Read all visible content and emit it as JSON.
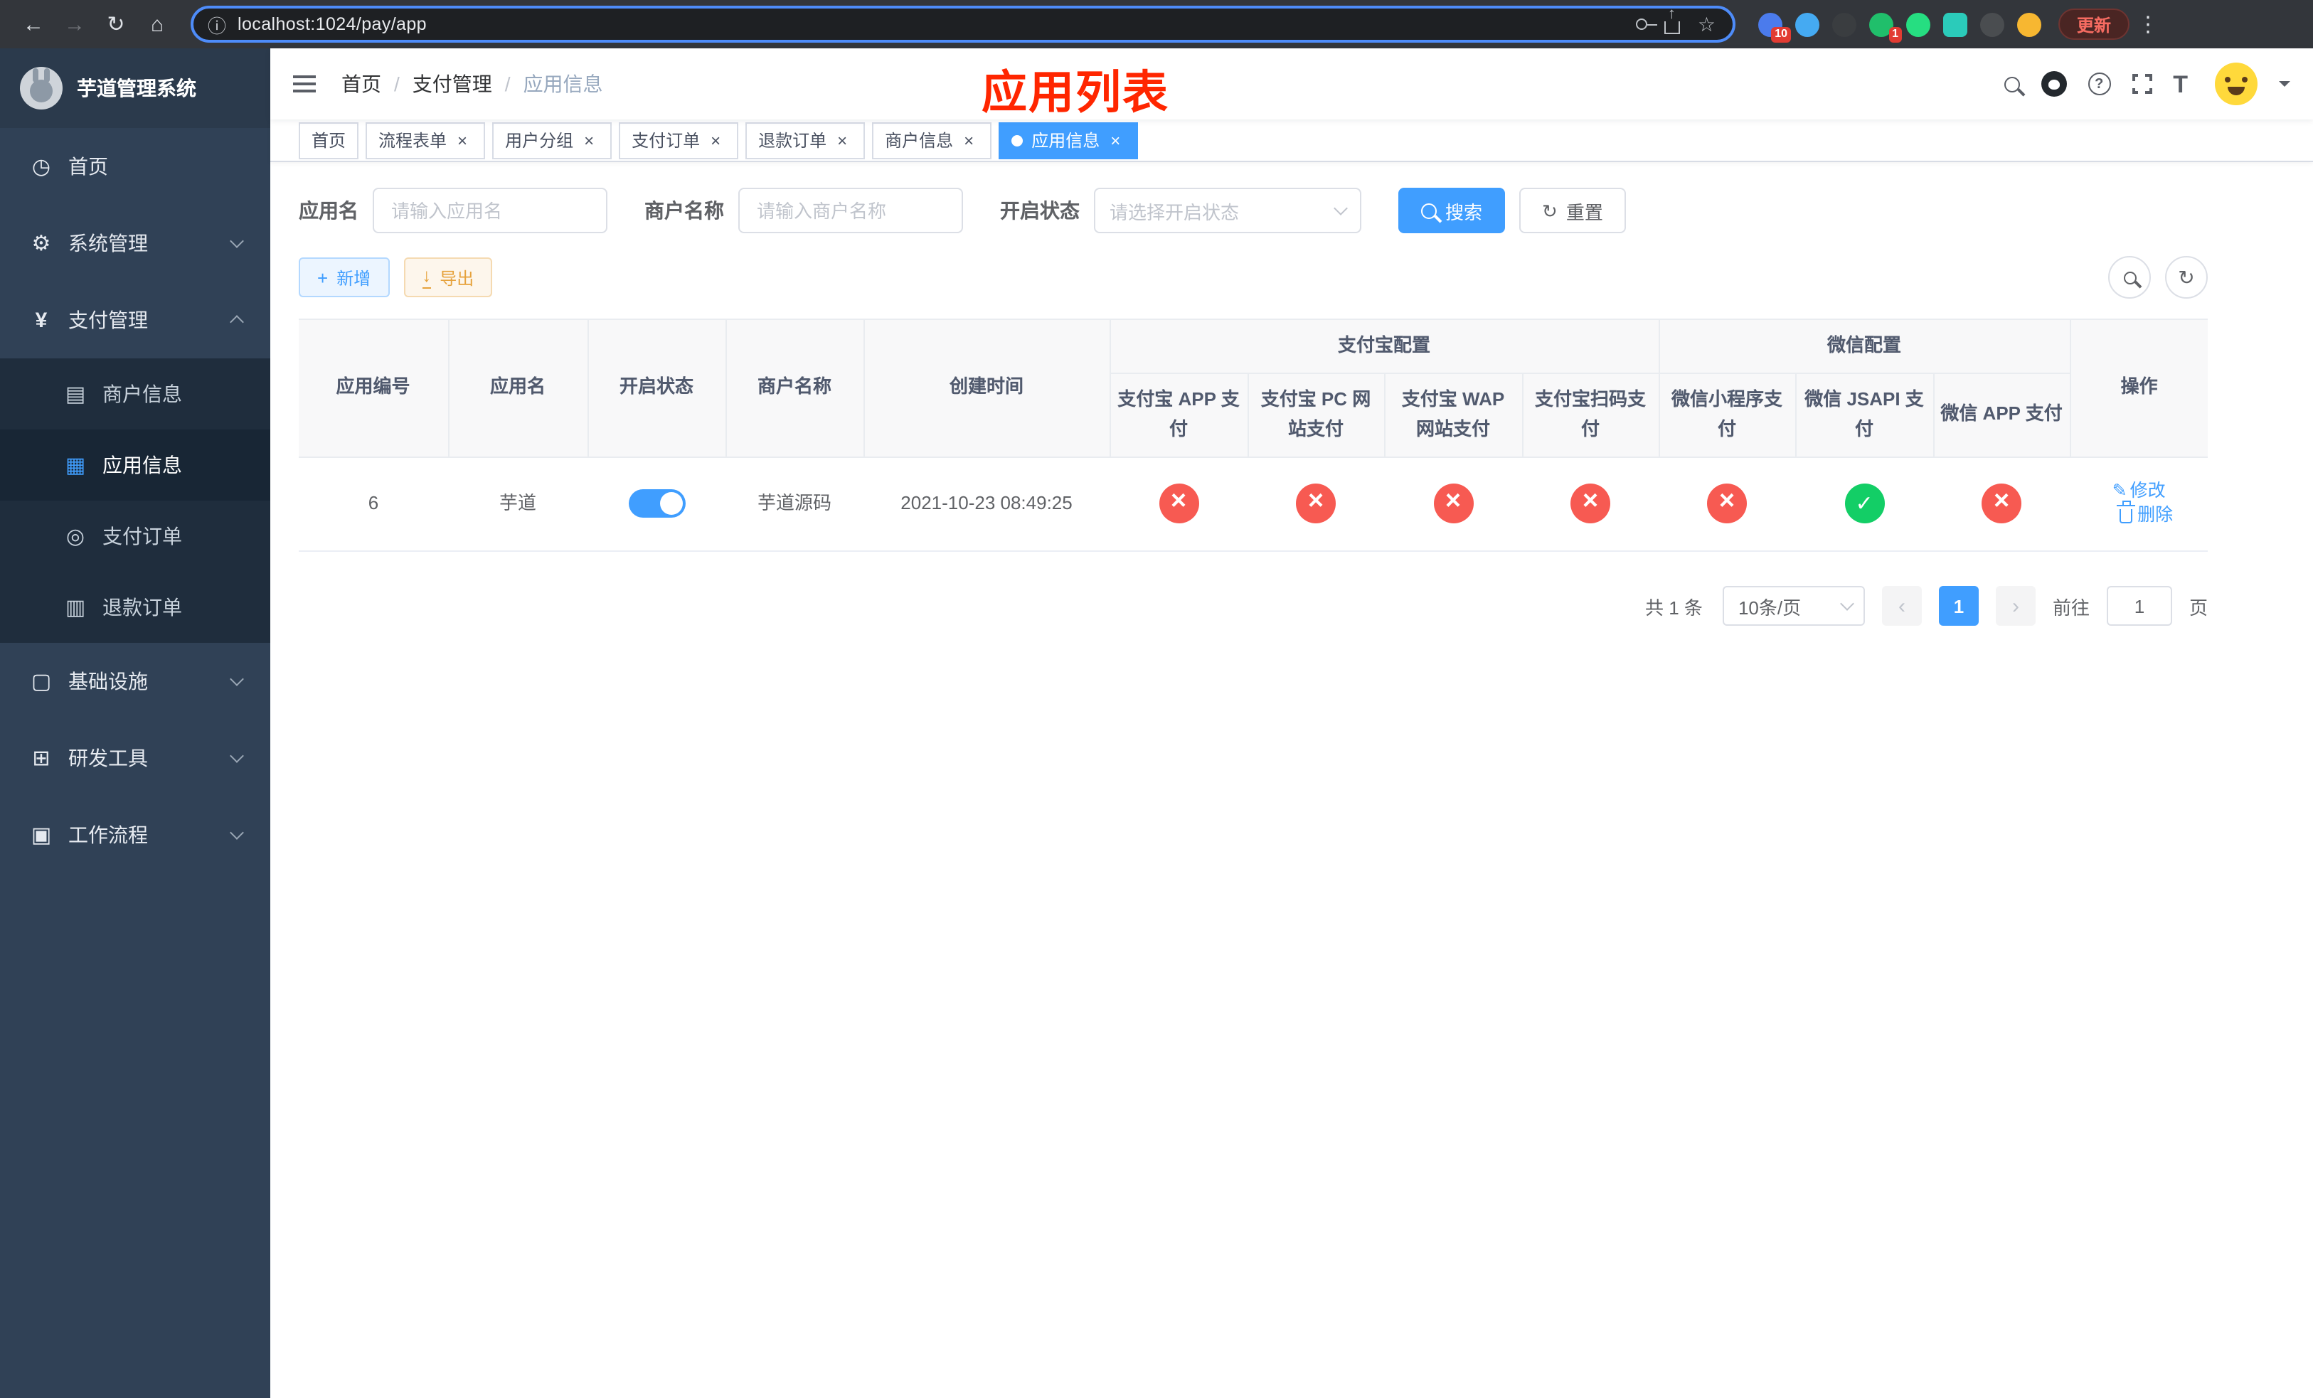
{
  "theme": {
    "primary": "#409eff",
    "success": "#13ce66",
    "danger": "#f75a52",
    "warning": "#e6a23c",
    "annotation_red": "#ff2600",
    "sidebar_bg": "#304156",
    "submenu_bg": "#1f2d3d"
  },
  "browser": {
    "url": "localhost:1024/pay/app",
    "update_button": "更新",
    "extension_badge_primary": "10",
    "extension_badge_secondary": "1"
  },
  "sidebar": {
    "title": "芋道管理系统",
    "menu": [
      {
        "label": "首页"
      },
      {
        "label": "系统管理"
      },
      {
        "label": "支付管理"
      },
      {
        "label": "基础设施"
      },
      {
        "label": "研发工具"
      },
      {
        "label": "工作流程"
      }
    ],
    "payment_children": [
      {
        "label": "商户信息"
      },
      {
        "label": "应用信息"
      },
      {
        "label": "支付订单"
      },
      {
        "label": "退款订单"
      }
    ]
  },
  "navbar": {
    "breadcrumb": [
      {
        "label": "首页"
      },
      {
        "label": "支付管理"
      },
      {
        "label": "应用信息"
      }
    ],
    "annotation": "应用列表"
  },
  "tabs": [
    {
      "label": "首页"
    },
    {
      "label": "流程表单"
    },
    {
      "label": "用户分组"
    },
    {
      "label": "支付订单"
    },
    {
      "label": "退款订单"
    },
    {
      "label": "商户信息"
    },
    {
      "label": "应用信息"
    }
  ],
  "filters": {
    "app_name_label": "应用名",
    "app_name_placeholder": "请输入应用名",
    "merchant_label": "商户名称",
    "merchant_placeholder": "请输入商户名称",
    "status_label": "开启状态",
    "status_placeholder": "请选择开启状态",
    "search_button": "搜索",
    "reset_button": "重置"
  },
  "toolbar": {
    "add_button": "新增",
    "export_button": "导出"
  },
  "table": {
    "headers": {
      "app_id": "应用编号",
      "app_name": "应用名",
      "status": "开启状态",
      "merchant": "商户名称",
      "created": "创建时间",
      "alipay_group": "支付宝配置",
      "wechat_group": "微信配置",
      "alipay_app": "支付宝 APP 支付",
      "alipay_pc": "支付宝 PC 网站支付",
      "alipay_wap": "支付宝 WAP 网站支付",
      "alipay_qr": "支付宝扫码支付",
      "wechat_lite": "微信小程序支付",
      "wechat_jsapi": "微信 JSAPI 支付",
      "wechat_app": "微信 APP 支付",
      "actions": "操作"
    },
    "rows": [
      {
        "app_id": "6",
        "app_name": "芋道",
        "enabled": true,
        "merchant": "芋道源码",
        "created": "2021-10-23 08:49:25",
        "alipay_app": false,
        "alipay_pc": false,
        "alipay_wap": false,
        "alipay_qr": false,
        "wechat_lite": false,
        "wechat_jsapi": true,
        "wechat_app": false
      }
    ],
    "row_actions": {
      "edit": "修改",
      "delete": "删除"
    }
  },
  "pagination": {
    "total_text": "共 1 条",
    "page_size": "10条/页",
    "current_page": "1",
    "goto_label": "前往",
    "goto_value": "1",
    "goto_suffix": "页"
  }
}
